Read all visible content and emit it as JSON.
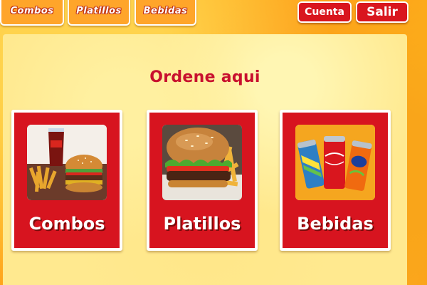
{
  "nav": {
    "tabs": [
      {
        "label": "Combos"
      },
      {
        "label": "Platillos"
      },
      {
        "label": "Bebidas"
      }
    ]
  },
  "account": {
    "cuenta_label": "Cuenta",
    "salir_label": "Salir"
  },
  "main": {
    "title": "Ordene aqui",
    "cards": [
      {
        "label": "Combos",
        "icon": "combo-meal-image"
      },
      {
        "label": "Platillos",
        "icon": "burger-fries-image"
      },
      {
        "label": "Bebidas",
        "icon": "soda-cans-image"
      }
    ]
  },
  "colors": {
    "accent_red": "#d7141f",
    "title_red": "#c8102e",
    "tab_orange": "#ffa52a",
    "panel_yellow": "#ffe98f"
  }
}
